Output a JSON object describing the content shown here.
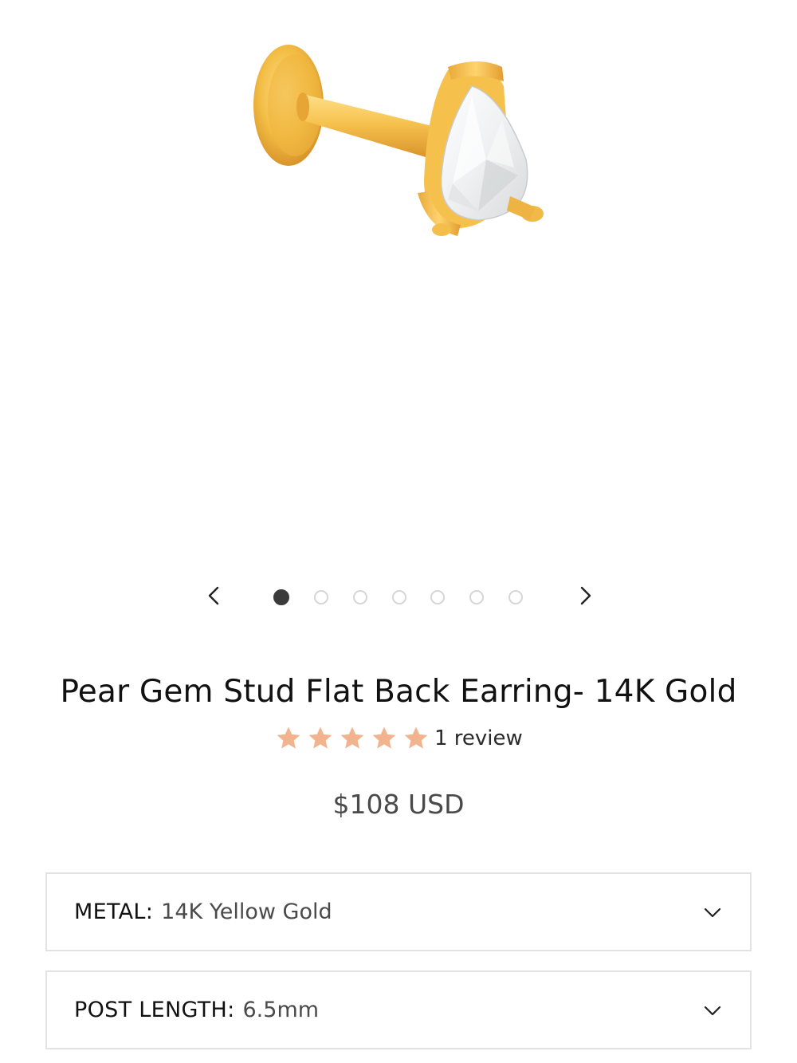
{
  "gallery": {
    "prev_icon": "chevron-left-icon",
    "next_icon": "chevron-right-icon",
    "slide_count": 7,
    "active_slide": 1
  },
  "product": {
    "title": "Pear Gem Stud Flat Back Earring- 14K Gold",
    "rating": 5,
    "rating_max": 5,
    "review_text": "1 review",
    "price": "$108 USD",
    "star_color": "#f2b48e"
  },
  "options": {
    "metal": {
      "label": "METAL:",
      "value": "14K Yellow Gold",
      "icon": "chevron-down-icon"
    },
    "post_length": {
      "label": "POST LENGTH:",
      "value": "6.5mm",
      "icon": "chevron-down-icon"
    }
  }
}
